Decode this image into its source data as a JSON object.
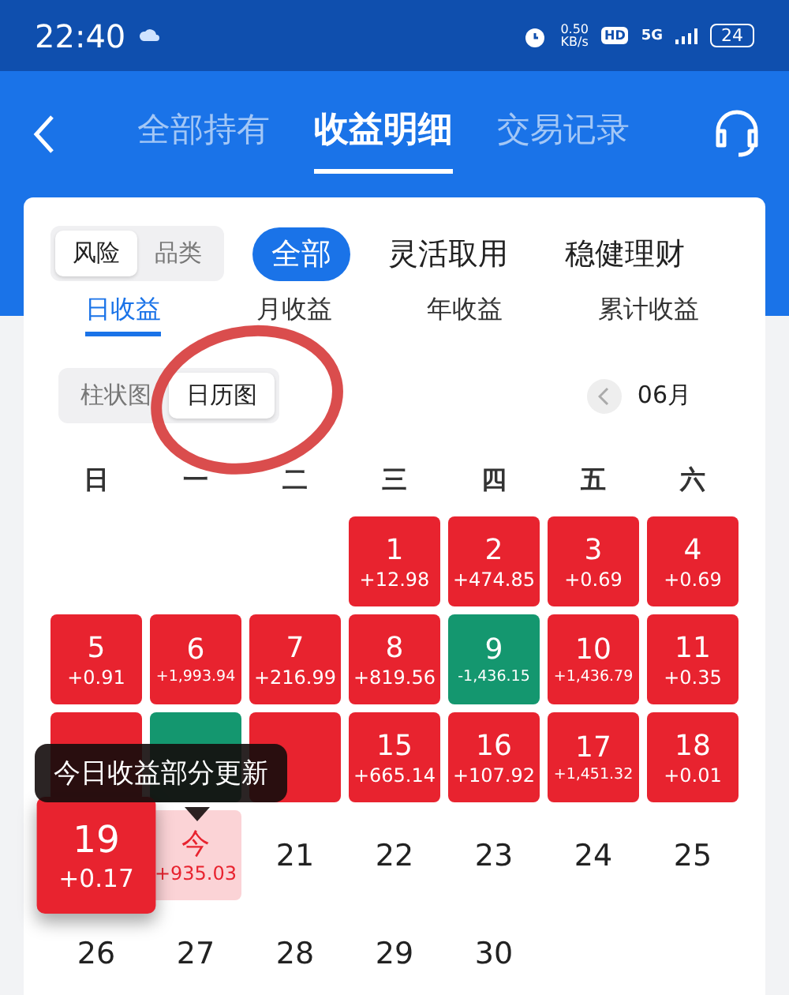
{
  "status_bar": {
    "time": "22:40",
    "speed": "0.50",
    "speed_unit": "KB/s",
    "hd": "HD",
    "network": "5G",
    "battery": "24"
  },
  "nav_tabs": [
    {
      "label": "全部持有",
      "selected": false
    },
    {
      "label": "收益明细",
      "selected": true
    },
    {
      "label": "交易记录",
      "selected": false
    }
  ],
  "filter_toggle": [
    {
      "label": "风险",
      "selected": true
    },
    {
      "label": "品类",
      "selected": false
    }
  ],
  "filter_chips": [
    {
      "label": "全部",
      "selected": true
    },
    {
      "label": "灵活取用",
      "selected": false
    },
    {
      "label": "稳健理财",
      "selected": false
    }
  ],
  "metric_tabs": [
    {
      "label": "日收益",
      "selected": true
    },
    {
      "label": "月收益",
      "selected": false
    },
    {
      "label": "年收益",
      "selected": false
    },
    {
      "label": "累计收益",
      "selected": false
    }
  ],
  "chart_toggle": [
    {
      "label": "柱状图",
      "selected": false
    },
    {
      "label": "日历图",
      "selected": true
    }
  ],
  "month": "06月",
  "weekdays": [
    "日",
    "一",
    "二",
    "三",
    "四",
    "五",
    "六"
  ],
  "days": [
    {
      "kind": "gain",
      "day": "1",
      "amount": "+12.98"
    },
    {
      "kind": "gain",
      "day": "2",
      "amount": "+474.85"
    },
    {
      "kind": "gain",
      "day": "3",
      "amount": "+0.69"
    },
    {
      "kind": "gain",
      "day": "4",
      "amount": "+0.69"
    },
    {
      "kind": "gain",
      "day": "5",
      "amount": "+0.91"
    },
    {
      "kind": "gain",
      "day": "6",
      "amount": "+1,993.94"
    },
    {
      "kind": "gain",
      "day": "7",
      "amount": "+216.99"
    },
    {
      "kind": "gain",
      "day": "8",
      "amount": "+819.56"
    },
    {
      "kind": "loss",
      "day": "9",
      "amount": "-1,436.15"
    },
    {
      "kind": "gain",
      "day": "10",
      "amount": "+1,436.79"
    },
    {
      "kind": "gain",
      "day": "11",
      "amount": "+0.35"
    },
    {
      "kind": "gain"
    },
    {
      "kind": "loss"
    },
    {
      "kind": "gain"
    },
    {
      "kind": "gain",
      "day": "15",
      "amount": "+665.14"
    },
    {
      "kind": "gain",
      "day": "16",
      "amount": "+107.92"
    },
    {
      "kind": "gain",
      "day": "17",
      "amount": "+1,451.32"
    },
    {
      "kind": "gain",
      "day": "18",
      "amount": "+0.01"
    },
    {
      "kind": "gain",
      "day": "19",
      "amount": "+0.17",
      "selected": true
    },
    {
      "kind": "today",
      "day": "今",
      "amount": "+935.03"
    },
    {
      "kind": "plain",
      "day": "21"
    },
    {
      "kind": "plain",
      "day": "22"
    },
    {
      "kind": "plain",
      "day": "23"
    },
    {
      "kind": "plain",
      "day": "24"
    },
    {
      "kind": "plain",
      "day": "25"
    },
    {
      "kind": "plain",
      "day": "26"
    },
    {
      "kind": "plain",
      "day": "27"
    },
    {
      "kind": "plain",
      "day": "28"
    },
    {
      "kind": "plain",
      "day": "29"
    },
    {
      "kind": "plain",
      "day": "30"
    }
  ],
  "tooltip": "今日收益部分更新"
}
